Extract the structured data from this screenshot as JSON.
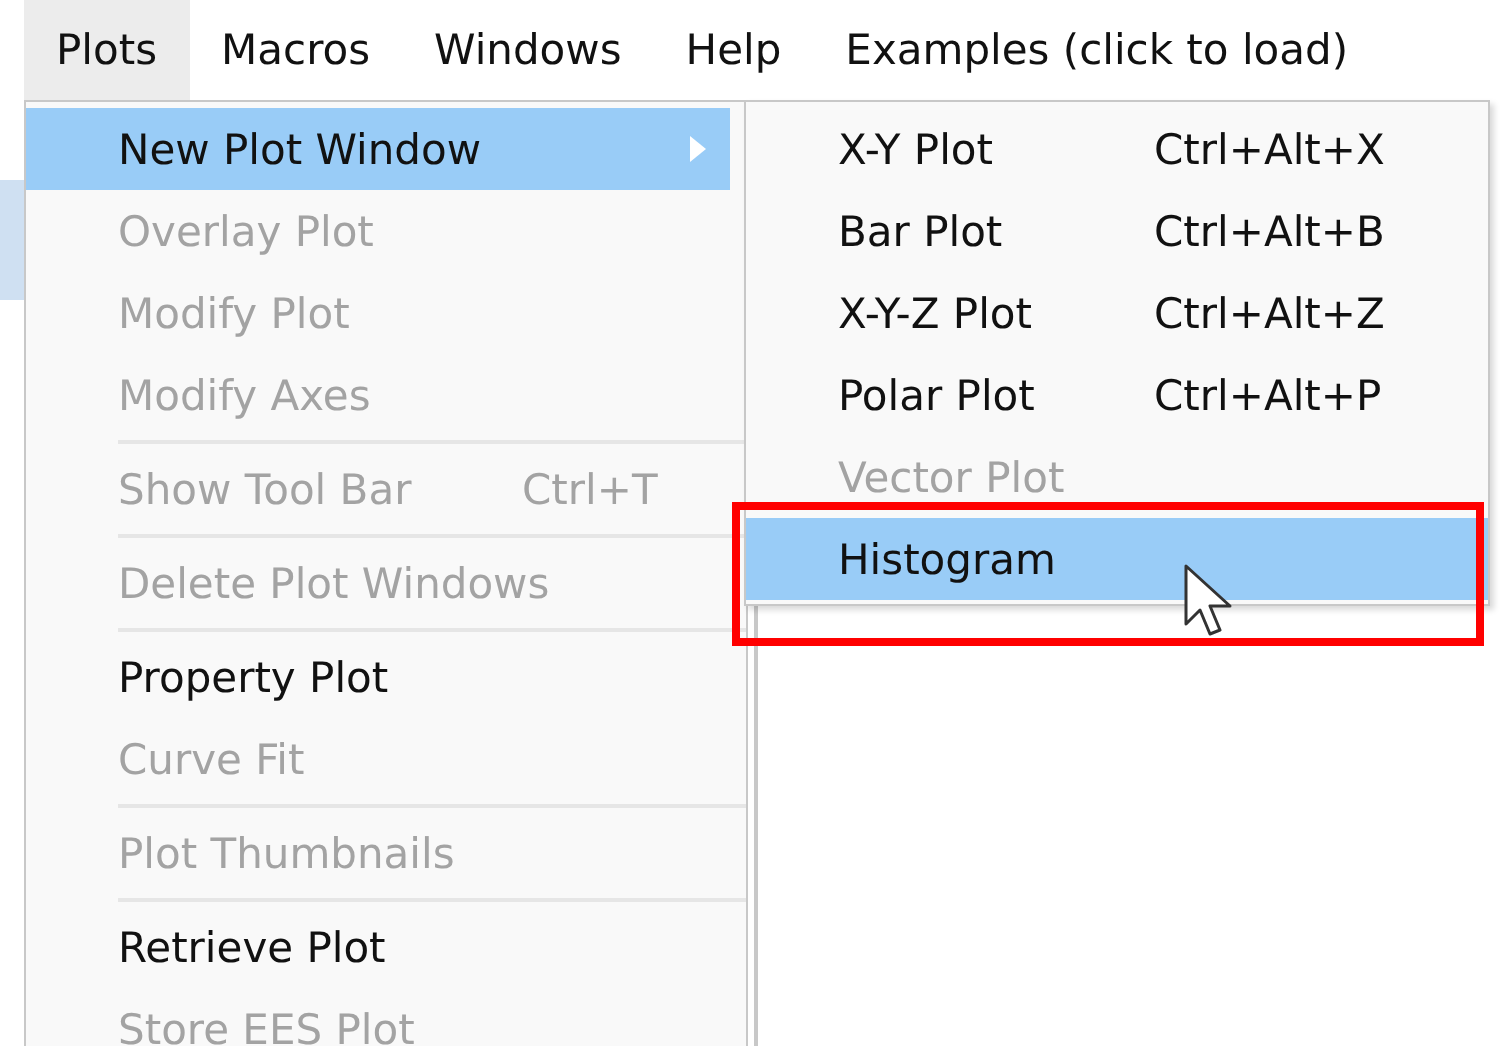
{
  "menu_bar": [
    {
      "label": "Plots",
      "selected": true
    },
    {
      "label": "Macros",
      "selected": false
    },
    {
      "label": "Windows",
      "selected": false
    },
    {
      "label": "Help",
      "selected": false
    },
    {
      "label": "Examples (click to load)",
      "selected": false
    }
  ],
  "menu": {
    "items": [
      {
        "kind": "item",
        "label": "New Plot Window",
        "disabled": false,
        "selected": true,
        "has_submenu": true
      },
      {
        "kind": "item",
        "label": "Overlay Plot",
        "disabled": true,
        "selected": false,
        "has_submenu": false
      },
      {
        "kind": "item",
        "label": "Modify Plot",
        "disabled": true,
        "selected": false,
        "has_submenu": false
      },
      {
        "kind": "item",
        "label": "Modify Axes",
        "disabled": true,
        "selected": false,
        "has_submenu": false
      },
      {
        "kind": "separator"
      },
      {
        "kind": "item",
        "label": "Show Tool Bar",
        "shortcut": "Ctrl+T",
        "disabled": true,
        "selected": false,
        "has_submenu": false
      },
      {
        "kind": "separator"
      },
      {
        "kind": "item",
        "label": "Delete Plot Windows",
        "disabled": true,
        "selected": false,
        "has_submenu": false
      },
      {
        "kind": "separator"
      },
      {
        "kind": "item",
        "label": "Property Plot",
        "disabled": false,
        "selected": false,
        "has_submenu": false
      },
      {
        "kind": "item",
        "label": "Curve Fit",
        "disabled": true,
        "selected": false,
        "has_submenu": false
      },
      {
        "kind": "separator"
      },
      {
        "kind": "item",
        "label": "Plot Thumbnails",
        "disabled": true,
        "selected": false,
        "has_submenu": false
      },
      {
        "kind": "separator"
      },
      {
        "kind": "item",
        "label": "Retrieve Plot",
        "disabled": false,
        "selected": false,
        "has_submenu": false
      },
      {
        "kind": "item",
        "label": "Store EES Plot",
        "disabled": true,
        "selected": false,
        "has_submenu": false
      }
    ]
  },
  "submenu": {
    "items": [
      {
        "label": "X-Y Plot",
        "shortcut": "Ctrl+Alt+X",
        "disabled": false,
        "selected": false
      },
      {
        "label": "Bar Plot",
        "shortcut": "Ctrl+Alt+B",
        "disabled": false,
        "selected": false
      },
      {
        "label": "X-Y-Z Plot",
        "shortcut": "Ctrl+Alt+Z",
        "disabled": false,
        "selected": false
      },
      {
        "label": "Polar Plot",
        "shortcut": "Ctrl+Alt+P",
        "disabled": false,
        "selected": false
      },
      {
        "label": "Vector Plot",
        "disabled": true,
        "selected": false
      },
      {
        "label": "Histogram",
        "disabled": false,
        "selected": true
      }
    ]
  }
}
